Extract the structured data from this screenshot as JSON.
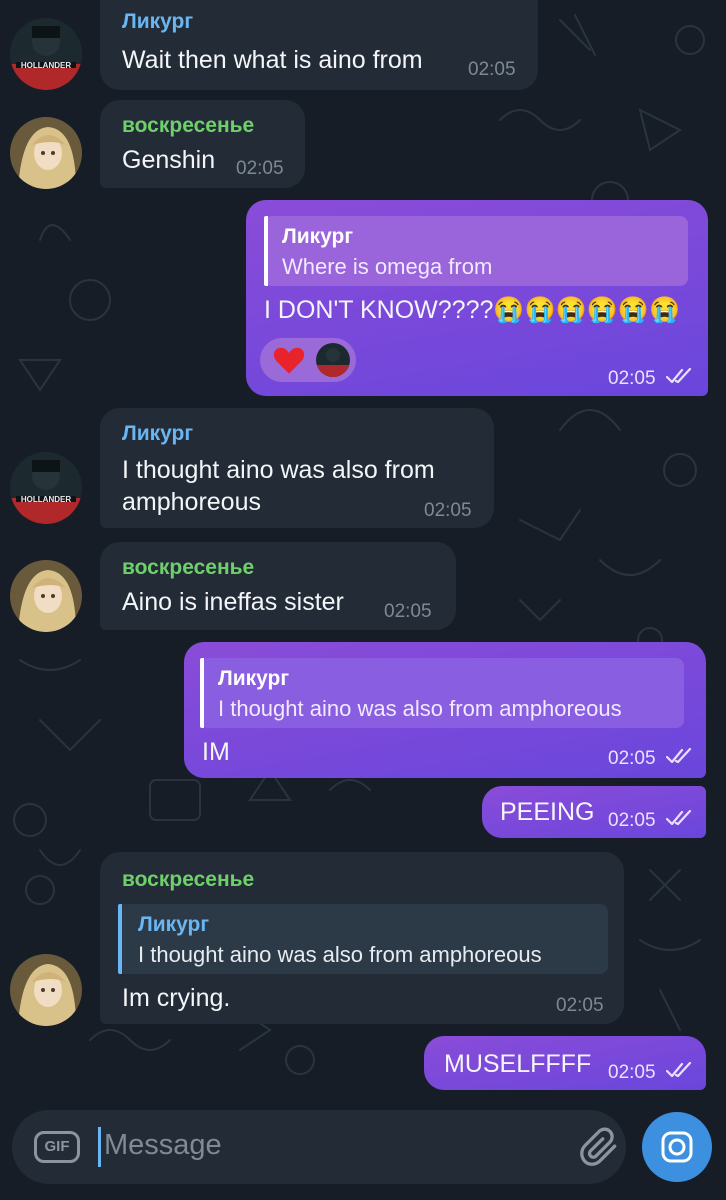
{
  "messages": [
    {
      "sender": "Ликург",
      "text": "Wait then what is aino from",
      "time": "02:05"
    },
    {
      "sender": "воскресенье",
      "text": "Genshin",
      "time": "02:05"
    },
    {
      "reply_to": {
        "name": "Ликург",
        "text": "Where is omega from"
      },
      "text": "I DON'T KNOW????😭😭😭😭😭😭",
      "time": "02:05",
      "reactions": [
        "heart",
        "avatar"
      ]
    },
    {
      "sender": "Ликург",
      "lines": [
        "I thought aino was also from",
        "amphoreous"
      ],
      "time": "02:05"
    },
    {
      "sender": "воскресенье",
      "text": "Aino is ineffas sister",
      "time": "02:05"
    },
    {
      "reply_to": {
        "name": "Ликург",
        "text": "I thought aino was also from amphoreous"
      },
      "text": "IM",
      "time": "02:05"
    },
    {
      "text": "PEEING",
      "time": "02:05"
    },
    {
      "sender": "воскресенье",
      "reply_to": {
        "name": "Ликург",
        "text": "I thought aino was also from amphoreous"
      },
      "text": "Im crying.",
      "time": "02:05"
    },
    {
      "text": "MUSELFFFF",
      "time": "02:05"
    }
  ],
  "input": {
    "placeholder": "Message",
    "gif_label": "GIF"
  },
  "icons": {
    "attach": "paperclip-icon",
    "camera": "camera-icon",
    "read": "double-check-icon"
  },
  "colors": {
    "background": "#161d26",
    "incoming_bubble": "#232c36",
    "outgoing_bubble": "#7a48dc",
    "sender_blue": "#6ab6f2",
    "sender_green": "#6fcf6a",
    "camera_button": "#3d8fe0"
  }
}
